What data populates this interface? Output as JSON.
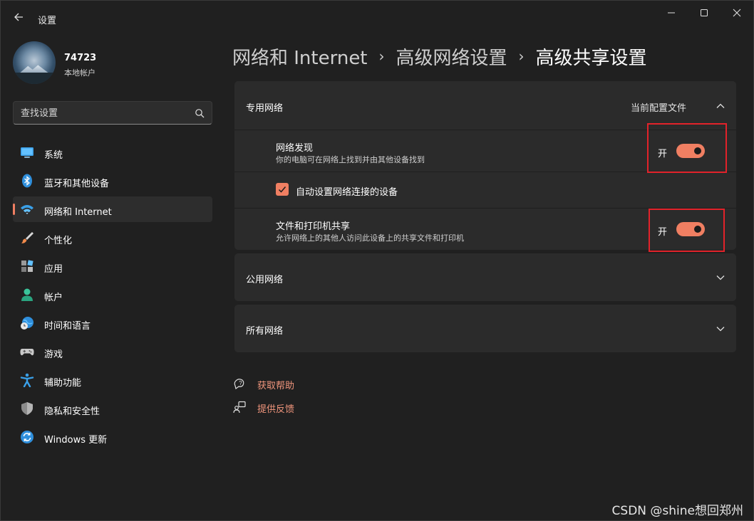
{
  "window": {
    "title": "设置"
  },
  "user": {
    "name": "74723",
    "account_type": "本地帐户"
  },
  "search": {
    "placeholder": "查找设置"
  },
  "nav": {
    "items": [
      {
        "label": "系统",
        "icon": "monitor-icon"
      },
      {
        "label": "蓝牙和其他设备",
        "icon": "bluetooth-icon"
      },
      {
        "label": "网络和 Internet",
        "icon": "wifi-icon",
        "active": true
      },
      {
        "label": "个性化",
        "icon": "brush-icon"
      },
      {
        "label": "应用",
        "icon": "apps-icon"
      },
      {
        "label": "帐户",
        "icon": "person-icon"
      },
      {
        "label": "时间和语言",
        "icon": "globe-clock-icon"
      },
      {
        "label": "游戏",
        "icon": "gamepad-icon"
      },
      {
        "label": "辅助功能",
        "icon": "accessibility-icon"
      },
      {
        "label": "隐私和安全性",
        "icon": "shield-icon"
      },
      {
        "label": "Windows 更新",
        "icon": "update-icon"
      }
    ]
  },
  "breadcrumb": {
    "items": [
      "网络和 Internet",
      "高级网络设置",
      "高级共享设置"
    ],
    "separator": "›"
  },
  "sections": {
    "private": {
      "title": "专用网络",
      "badge": "当前配置文件",
      "expanded": true,
      "network_discovery": {
        "title": "网络发现",
        "description": "你的电脑可在网络上找到并由其他设备找到",
        "state": "开",
        "on": true
      },
      "auto_setup": {
        "label": "自动设置网络连接的设备",
        "checked": true
      },
      "file_printer_sharing": {
        "title": "文件和打印机共享",
        "description": "允许网络上的其他人访问此设备上的共享文件和打印机",
        "state": "开",
        "on": true
      }
    },
    "public": {
      "title": "公用网络",
      "expanded": false
    },
    "all": {
      "title": "所有网络",
      "expanded": false
    }
  },
  "links": {
    "help": "获取帮助",
    "feedback": "提供反馈"
  },
  "watermark": "CSDN @shine想回郑州",
  "colors": {
    "accent": "#f07f62",
    "highlight_box": "#e2222a",
    "background": "#202020",
    "card": "#2b2b2b"
  }
}
